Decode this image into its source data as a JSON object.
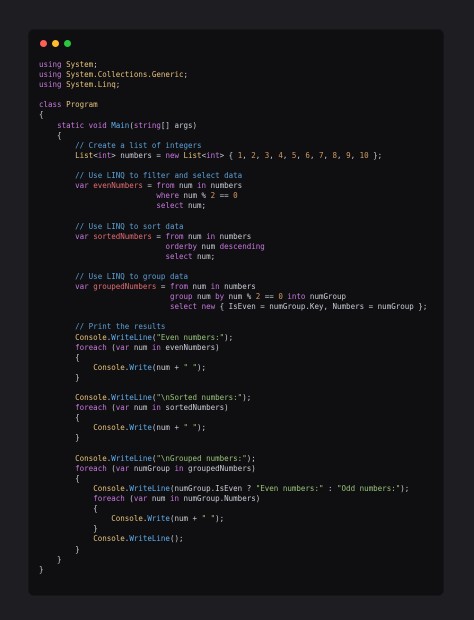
{
  "window": {
    "buttons": [
      "close",
      "minimize",
      "maximize"
    ],
    "colors": {
      "close": "#fe5f57",
      "minimize": "#febc2e",
      "maximize": "#28c840"
    }
  },
  "code": {
    "language": "C#",
    "lines": [
      [
        [
          "kw",
          "using"
        ],
        [
          "pl",
          " "
        ],
        [
          "tp",
          "System"
        ],
        [
          "pl",
          ";"
        ]
      ],
      [
        [
          "kw",
          "using"
        ],
        [
          "pl",
          " "
        ],
        [
          "tp",
          "System.Collections.Generic"
        ],
        [
          "pl",
          ";"
        ]
      ],
      [
        [
          "kw",
          "using"
        ],
        [
          "pl",
          " "
        ],
        [
          "tp",
          "System.Linq"
        ],
        [
          "pl",
          ";"
        ]
      ],
      [],
      [
        [
          "kw",
          "class"
        ],
        [
          "pl",
          " "
        ],
        [
          "tp",
          "Program"
        ]
      ],
      [
        [
          "pl",
          "{"
        ]
      ],
      [
        [
          "pl",
          "    "
        ],
        [
          "kw",
          "static"
        ],
        [
          "pl",
          " "
        ],
        [
          "kw",
          "void"
        ],
        [
          "pl",
          " "
        ],
        [
          "fn",
          "Main"
        ],
        [
          "pl",
          "("
        ],
        [
          "kw",
          "string"
        ],
        [
          "pl",
          "[] args)"
        ]
      ],
      [
        [
          "pl",
          "    {"
        ]
      ],
      [
        [
          "pl",
          "        "
        ],
        [
          "cm",
          "// Create a list of integers"
        ]
      ],
      [
        [
          "pl",
          "        "
        ],
        [
          "tp",
          "List"
        ],
        [
          "pl",
          "<"
        ],
        [
          "kw",
          "int"
        ],
        [
          "pl",
          "> numbers = "
        ],
        [
          "kw",
          "new"
        ],
        [
          "pl",
          " "
        ],
        [
          "tp",
          "List"
        ],
        [
          "pl",
          "<"
        ],
        [
          "kw",
          "int"
        ],
        [
          "pl",
          "> { "
        ],
        [
          "nm",
          "1"
        ],
        [
          "pl",
          ", "
        ],
        [
          "nm",
          "2"
        ],
        [
          "pl",
          ", "
        ],
        [
          "nm",
          "3"
        ],
        [
          "pl",
          ", "
        ],
        [
          "nm",
          "4"
        ],
        [
          "pl",
          ", "
        ],
        [
          "nm",
          "5"
        ],
        [
          "pl",
          ", "
        ],
        [
          "nm",
          "6"
        ],
        [
          "pl",
          ", "
        ],
        [
          "nm",
          "7"
        ],
        [
          "pl",
          ", "
        ],
        [
          "nm",
          "8"
        ],
        [
          "pl",
          ", "
        ],
        [
          "nm",
          "9"
        ],
        [
          "pl",
          ", "
        ],
        [
          "nm",
          "10"
        ],
        [
          "pl",
          " };"
        ]
      ],
      [],
      [
        [
          "pl",
          "        "
        ],
        [
          "cm",
          "// Use LINQ to filter and select data"
        ]
      ],
      [
        [
          "pl",
          "        "
        ],
        [
          "kw",
          "var"
        ],
        [
          "pl",
          " "
        ],
        [
          "id",
          "evenNumbers"
        ],
        [
          "pl",
          " = "
        ],
        [
          "kw",
          "from"
        ],
        [
          "pl",
          " num "
        ],
        [
          "kw",
          "in"
        ],
        [
          "pl",
          " numbers"
        ]
      ],
      [
        [
          "pl",
          "                          "
        ],
        [
          "kw",
          "where"
        ],
        [
          "pl",
          " num % "
        ],
        [
          "nm",
          "2"
        ],
        [
          "pl",
          " == "
        ],
        [
          "nm",
          "0"
        ]
      ],
      [
        [
          "pl",
          "                          "
        ],
        [
          "kw",
          "select"
        ],
        [
          "pl",
          " num;"
        ]
      ],
      [],
      [
        [
          "pl",
          "        "
        ],
        [
          "cm",
          "// Use LINQ to sort data"
        ]
      ],
      [
        [
          "pl",
          "        "
        ],
        [
          "kw",
          "var"
        ],
        [
          "pl",
          " "
        ],
        [
          "id",
          "sortedNumbers"
        ],
        [
          "pl",
          " = "
        ],
        [
          "kw",
          "from"
        ],
        [
          "pl",
          " num "
        ],
        [
          "kw",
          "in"
        ],
        [
          "pl",
          " numbers"
        ]
      ],
      [
        [
          "pl",
          "                            "
        ],
        [
          "kw",
          "orderby"
        ],
        [
          "pl",
          " num "
        ],
        [
          "kw",
          "descending"
        ]
      ],
      [
        [
          "pl",
          "                            "
        ],
        [
          "kw",
          "select"
        ],
        [
          "pl",
          " num;"
        ]
      ],
      [],
      [
        [
          "pl",
          "        "
        ],
        [
          "cm",
          "// Use LINQ to group data"
        ]
      ],
      [
        [
          "pl",
          "        "
        ],
        [
          "kw",
          "var"
        ],
        [
          "pl",
          " "
        ],
        [
          "id",
          "groupedNumbers"
        ],
        [
          "pl",
          " = "
        ],
        [
          "kw",
          "from"
        ],
        [
          "pl",
          " num "
        ],
        [
          "kw",
          "in"
        ],
        [
          "pl",
          " numbers"
        ]
      ],
      [
        [
          "pl",
          "                             "
        ],
        [
          "kw",
          "group"
        ],
        [
          "pl",
          " num "
        ],
        [
          "kw",
          "by"
        ],
        [
          "pl",
          " num % "
        ],
        [
          "nm",
          "2"
        ],
        [
          "pl",
          " == "
        ],
        [
          "nm",
          "0"
        ],
        [
          "pl",
          " "
        ],
        [
          "kw",
          "into"
        ],
        [
          "pl",
          " numGroup"
        ]
      ],
      [
        [
          "pl",
          "                             "
        ],
        [
          "kw",
          "select"
        ],
        [
          "pl",
          " "
        ],
        [
          "kw",
          "new"
        ],
        [
          "pl",
          " { IsEven = numGroup.Key, Numbers = numGroup };"
        ]
      ],
      [],
      [
        [
          "pl",
          "        "
        ],
        [
          "cm",
          "// Print the results"
        ]
      ],
      [
        [
          "pl",
          "        "
        ],
        [
          "tp",
          "Console"
        ],
        [
          "pl",
          "."
        ],
        [
          "fn",
          "WriteLine"
        ],
        [
          "pl",
          "("
        ],
        [
          "st",
          "\"Even numbers:\""
        ],
        [
          "pl",
          ");"
        ]
      ],
      [
        [
          "pl",
          "        "
        ],
        [
          "kw",
          "foreach"
        ],
        [
          "pl",
          " ("
        ],
        [
          "kw",
          "var"
        ],
        [
          "pl",
          " num "
        ],
        [
          "kw",
          "in"
        ],
        [
          "pl",
          " evenNumbers)"
        ]
      ],
      [
        [
          "pl",
          "        {"
        ]
      ],
      [
        [
          "pl",
          "            "
        ],
        [
          "tp",
          "Console"
        ],
        [
          "pl",
          "."
        ],
        [
          "fn",
          "Write"
        ],
        [
          "pl",
          "(num + "
        ],
        [
          "st",
          "\" \""
        ],
        [
          "pl",
          ");"
        ]
      ],
      [
        [
          "pl",
          "        }"
        ]
      ],
      [],
      [
        [
          "pl",
          "        "
        ],
        [
          "tp",
          "Console"
        ],
        [
          "pl",
          "."
        ],
        [
          "fn",
          "WriteLine"
        ],
        [
          "pl",
          "("
        ],
        [
          "st",
          "\"\\nSorted numbers:\""
        ],
        [
          "pl",
          ");"
        ]
      ],
      [
        [
          "pl",
          "        "
        ],
        [
          "kw",
          "foreach"
        ],
        [
          "pl",
          " ("
        ],
        [
          "kw",
          "var"
        ],
        [
          "pl",
          " num "
        ],
        [
          "kw",
          "in"
        ],
        [
          "pl",
          " sortedNumbers)"
        ]
      ],
      [
        [
          "pl",
          "        {"
        ]
      ],
      [
        [
          "pl",
          "            "
        ],
        [
          "tp",
          "Console"
        ],
        [
          "pl",
          "."
        ],
        [
          "fn",
          "Write"
        ],
        [
          "pl",
          "(num + "
        ],
        [
          "st",
          "\" \""
        ],
        [
          "pl",
          ");"
        ]
      ],
      [
        [
          "pl",
          "        }"
        ]
      ],
      [],
      [
        [
          "pl",
          "        "
        ],
        [
          "tp",
          "Console"
        ],
        [
          "pl",
          "."
        ],
        [
          "fn",
          "WriteLine"
        ],
        [
          "pl",
          "("
        ],
        [
          "st",
          "\"\\nGrouped numbers:\""
        ],
        [
          "pl",
          ");"
        ]
      ],
      [
        [
          "pl",
          "        "
        ],
        [
          "kw",
          "foreach"
        ],
        [
          "pl",
          " ("
        ],
        [
          "kw",
          "var"
        ],
        [
          "pl",
          " numGroup "
        ],
        [
          "kw",
          "in"
        ],
        [
          "pl",
          " groupedNumbers)"
        ]
      ],
      [
        [
          "pl",
          "        {"
        ]
      ],
      [
        [
          "pl",
          "            "
        ],
        [
          "tp",
          "Console"
        ],
        [
          "pl",
          "."
        ],
        [
          "fn",
          "WriteLine"
        ],
        [
          "pl",
          "(numGroup.IsEven ? "
        ],
        [
          "st",
          "\"Even numbers:\""
        ],
        [
          "pl",
          " : "
        ],
        [
          "st",
          "\"Odd numbers:\""
        ],
        [
          "pl",
          ");"
        ]
      ],
      [
        [
          "pl",
          "            "
        ],
        [
          "kw",
          "foreach"
        ],
        [
          "pl",
          " ("
        ],
        [
          "kw",
          "var"
        ],
        [
          "pl",
          " num "
        ],
        [
          "kw",
          "in"
        ],
        [
          "pl",
          " numGroup.Numbers)"
        ]
      ],
      [
        [
          "pl",
          "            {"
        ]
      ],
      [
        [
          "pl",
          "                "
        ],
        [
          "tp",
          "Console"
        ],
        [
          "pl",
          "."
        ],
        [
          "fn",
          "Write"
        ],
        [
          "pl",
          "(num + "
        ],
        [
          "st",
          "\" \""
        ],
        [
          "pl",
          ");"
        ]
      ],
      [
        [
          "pl",
          "            }"
        ]
      ],
      [
        [
          "pl",
          "            "
        ],
        [
          "tp",
          "Console"
        ],
        [
          "pl",
          "."
        ],
        [
          "fn",
          "WriteLine"
        ],
        [
          "pl",
          "();"
        ]
      ],
      [
        [
          "pl",
          "        }"
        ]
      ],
      [
        [
          "pl",
          "    }"
        ]
      ],
      [
        [
          "pl",
          "}"
        ]
      ]
    ]
  }
}
